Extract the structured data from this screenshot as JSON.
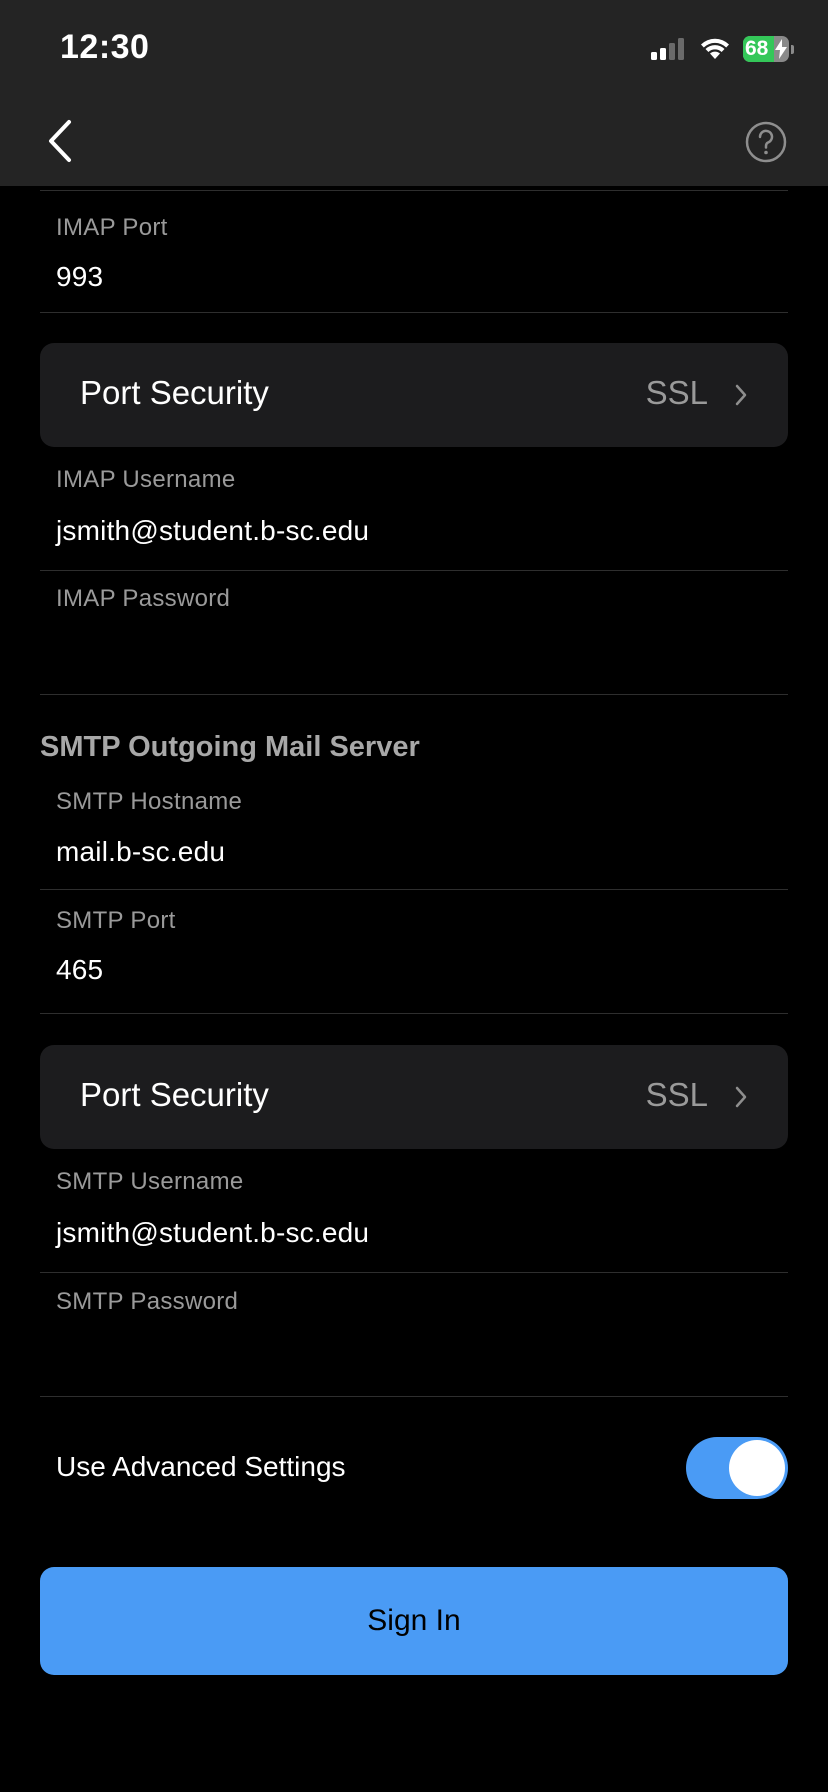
{
  "status_bar": {
    "time": "12:30",
    "battery_level": "68",
    "battery_fraction": 0.68,
    "icons": [
      "cellular-signal-icon",
      "wifi-icon",
      "battery-charging-icon"
    ]
  },
  "nav": {
    "back_icon": "chevron-left-icon",
    "help_icon": "question-circle-icon"
  },
  "imap": {
    "port_label": "IMAP Port",
    "port_value": "993",
    "security_label": "Port Security",
    "security_value": "SSL",
    "username_label": "IMAP Username",
    "username_value": "jsmith@student.b-sc.edu",
    "password_label": "IMAP Password",
    "password_value": ""
  },
  "smtp": {
    "section_title": "SMTP Outgoing Mail Server",
    "hostname_label": "SMTP Hostname",
    "hostname_value": "mail.b-sc.edu",
    "port_label": "SMTP Port",
    "port_value": "465",
    "security_label": "Port Security",
    "security_value": "SSL",
    "username_label": "SMTP Username",
    "username_value": "jsmith@student.b-sc.edu",
    "password_label": "SMTP Password",
    "password_value": ""
  },
  "advanced": {
    "label": "Use Advanced Settings",
    "enabled": true
  },
  "sign_in": {
    "label": "Sign In"
  },
  "colors": {
    "accent": "#4a9bf5",
    "background": "#000000",
    "header": "#242424",
    "row": "#1c1c1e",
    "battery": "#34c759"
  }
}
